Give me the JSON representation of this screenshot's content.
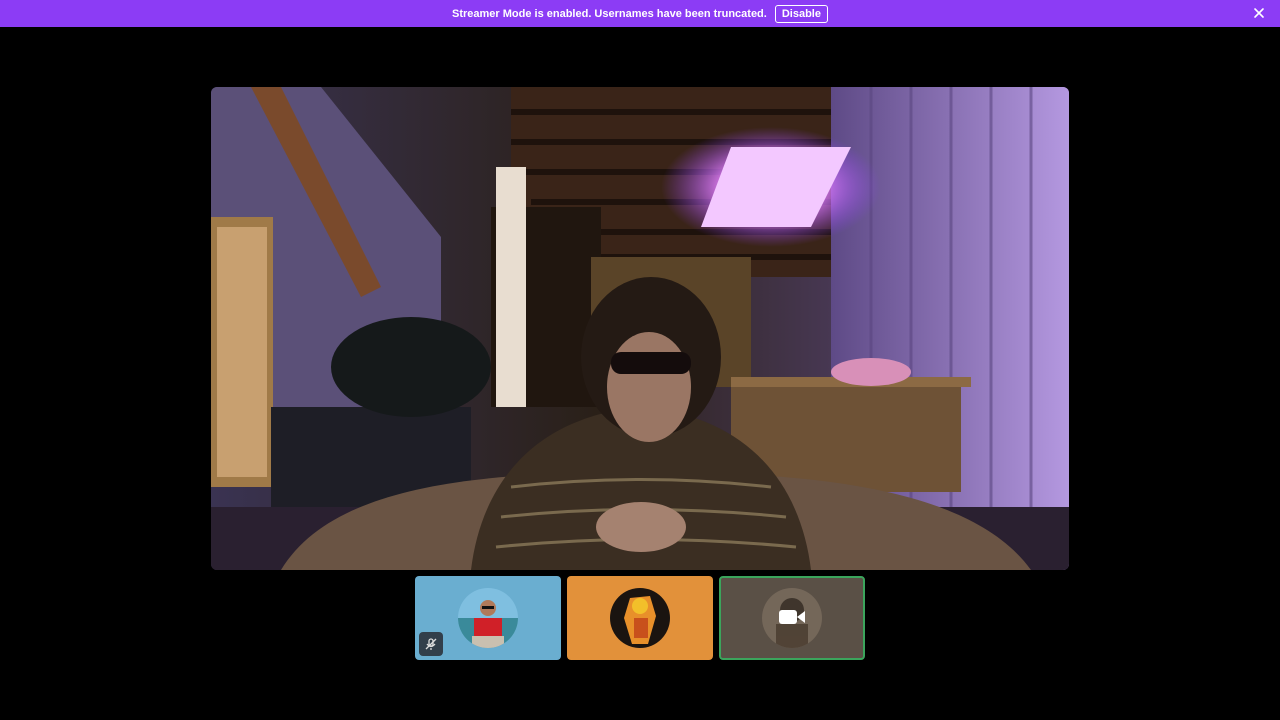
{
  "banner": {
    "message": "Streamer Mode is enabled. Usernames have been truncated.",
    "disable_label": "Disable",
    "close_icon": "close-icon",
    "color": "#8c3cf5"
  },
  "main_video": {
    "icon": "webcam-stream"
  },
  "tiles": [
    {
      "bg": "#6aaed0",
      "icon": "mic-muted-icon",
      "selected": false
    },
    {
      "bg": "#e2913a",
      "selected": false
    },
    {
      "bg": "#5a5046",
      "icon": "video-camera-icon",
      "selected": true,
      "outline": "#3ba55c"
    }
  ]
}
